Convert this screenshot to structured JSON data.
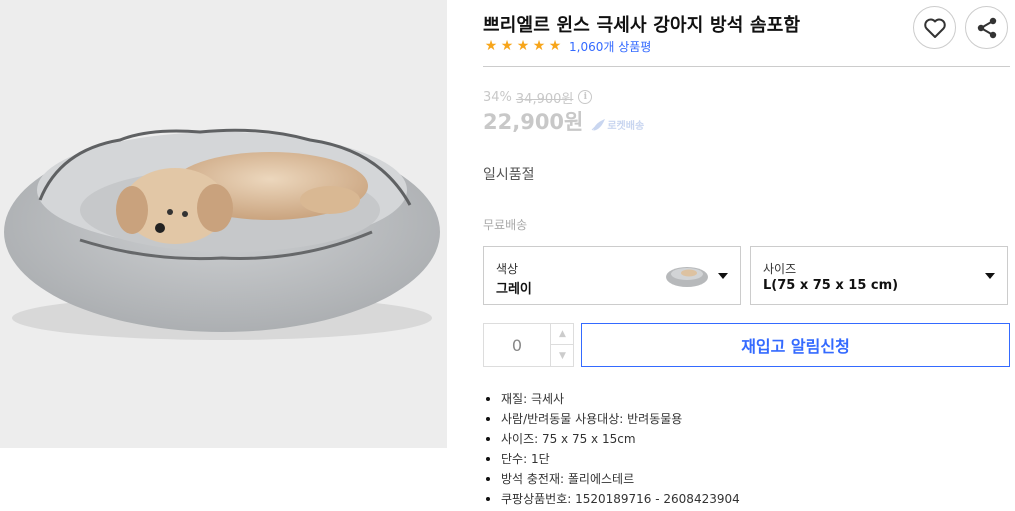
{
  "product": {
    "title": "쁘리엘르 윈스 극세사 강아지 방석 솜포함",
    "rating_stars": 5,
    "review_count": "1,060개 상품평",
    "discount_rate": "34%",
    "original_price": "34,900원",
    "sale_price": "22,900원",
    "rocket_label": "로켓배송",
    "status": "일시품절",
    "shipping": "무료배송",
    "image_icon": "dog-bed-photo"
  },
  "actions": {
    "wish_icon": "heart-icon",
    "share_icon": "share-icon"
  },
  "options": {
    "color": {
      "label": "색상",
      "value": "그레이"
    },
    "size": {
      "label": "사이즈",
      "value": "L(75 x 75 x 15 cm)"
    }
  },
  "quantity": {
    "value": "0",
    "up": "▲",
    "down": "▼"
  },
  "restock_button": "재입고 알림신청",
  "specs": [
    "재질: 극세사",
    "사람/반려동물 사용대상: 반려동물용",
    "사이즈: 75 x 75 x 15cm",
    "단수: 1단",
    "방석 충전재: 폴리에스테르",
    "쿠팡상품번호: 1520189716 - 2608423904"
  ],
  "colors": {
    "accent": "#346aff",
    "star": "#f7a51a",
    "muted": "#c8c8c8",
    "border": "#cccccc"
  }
}
